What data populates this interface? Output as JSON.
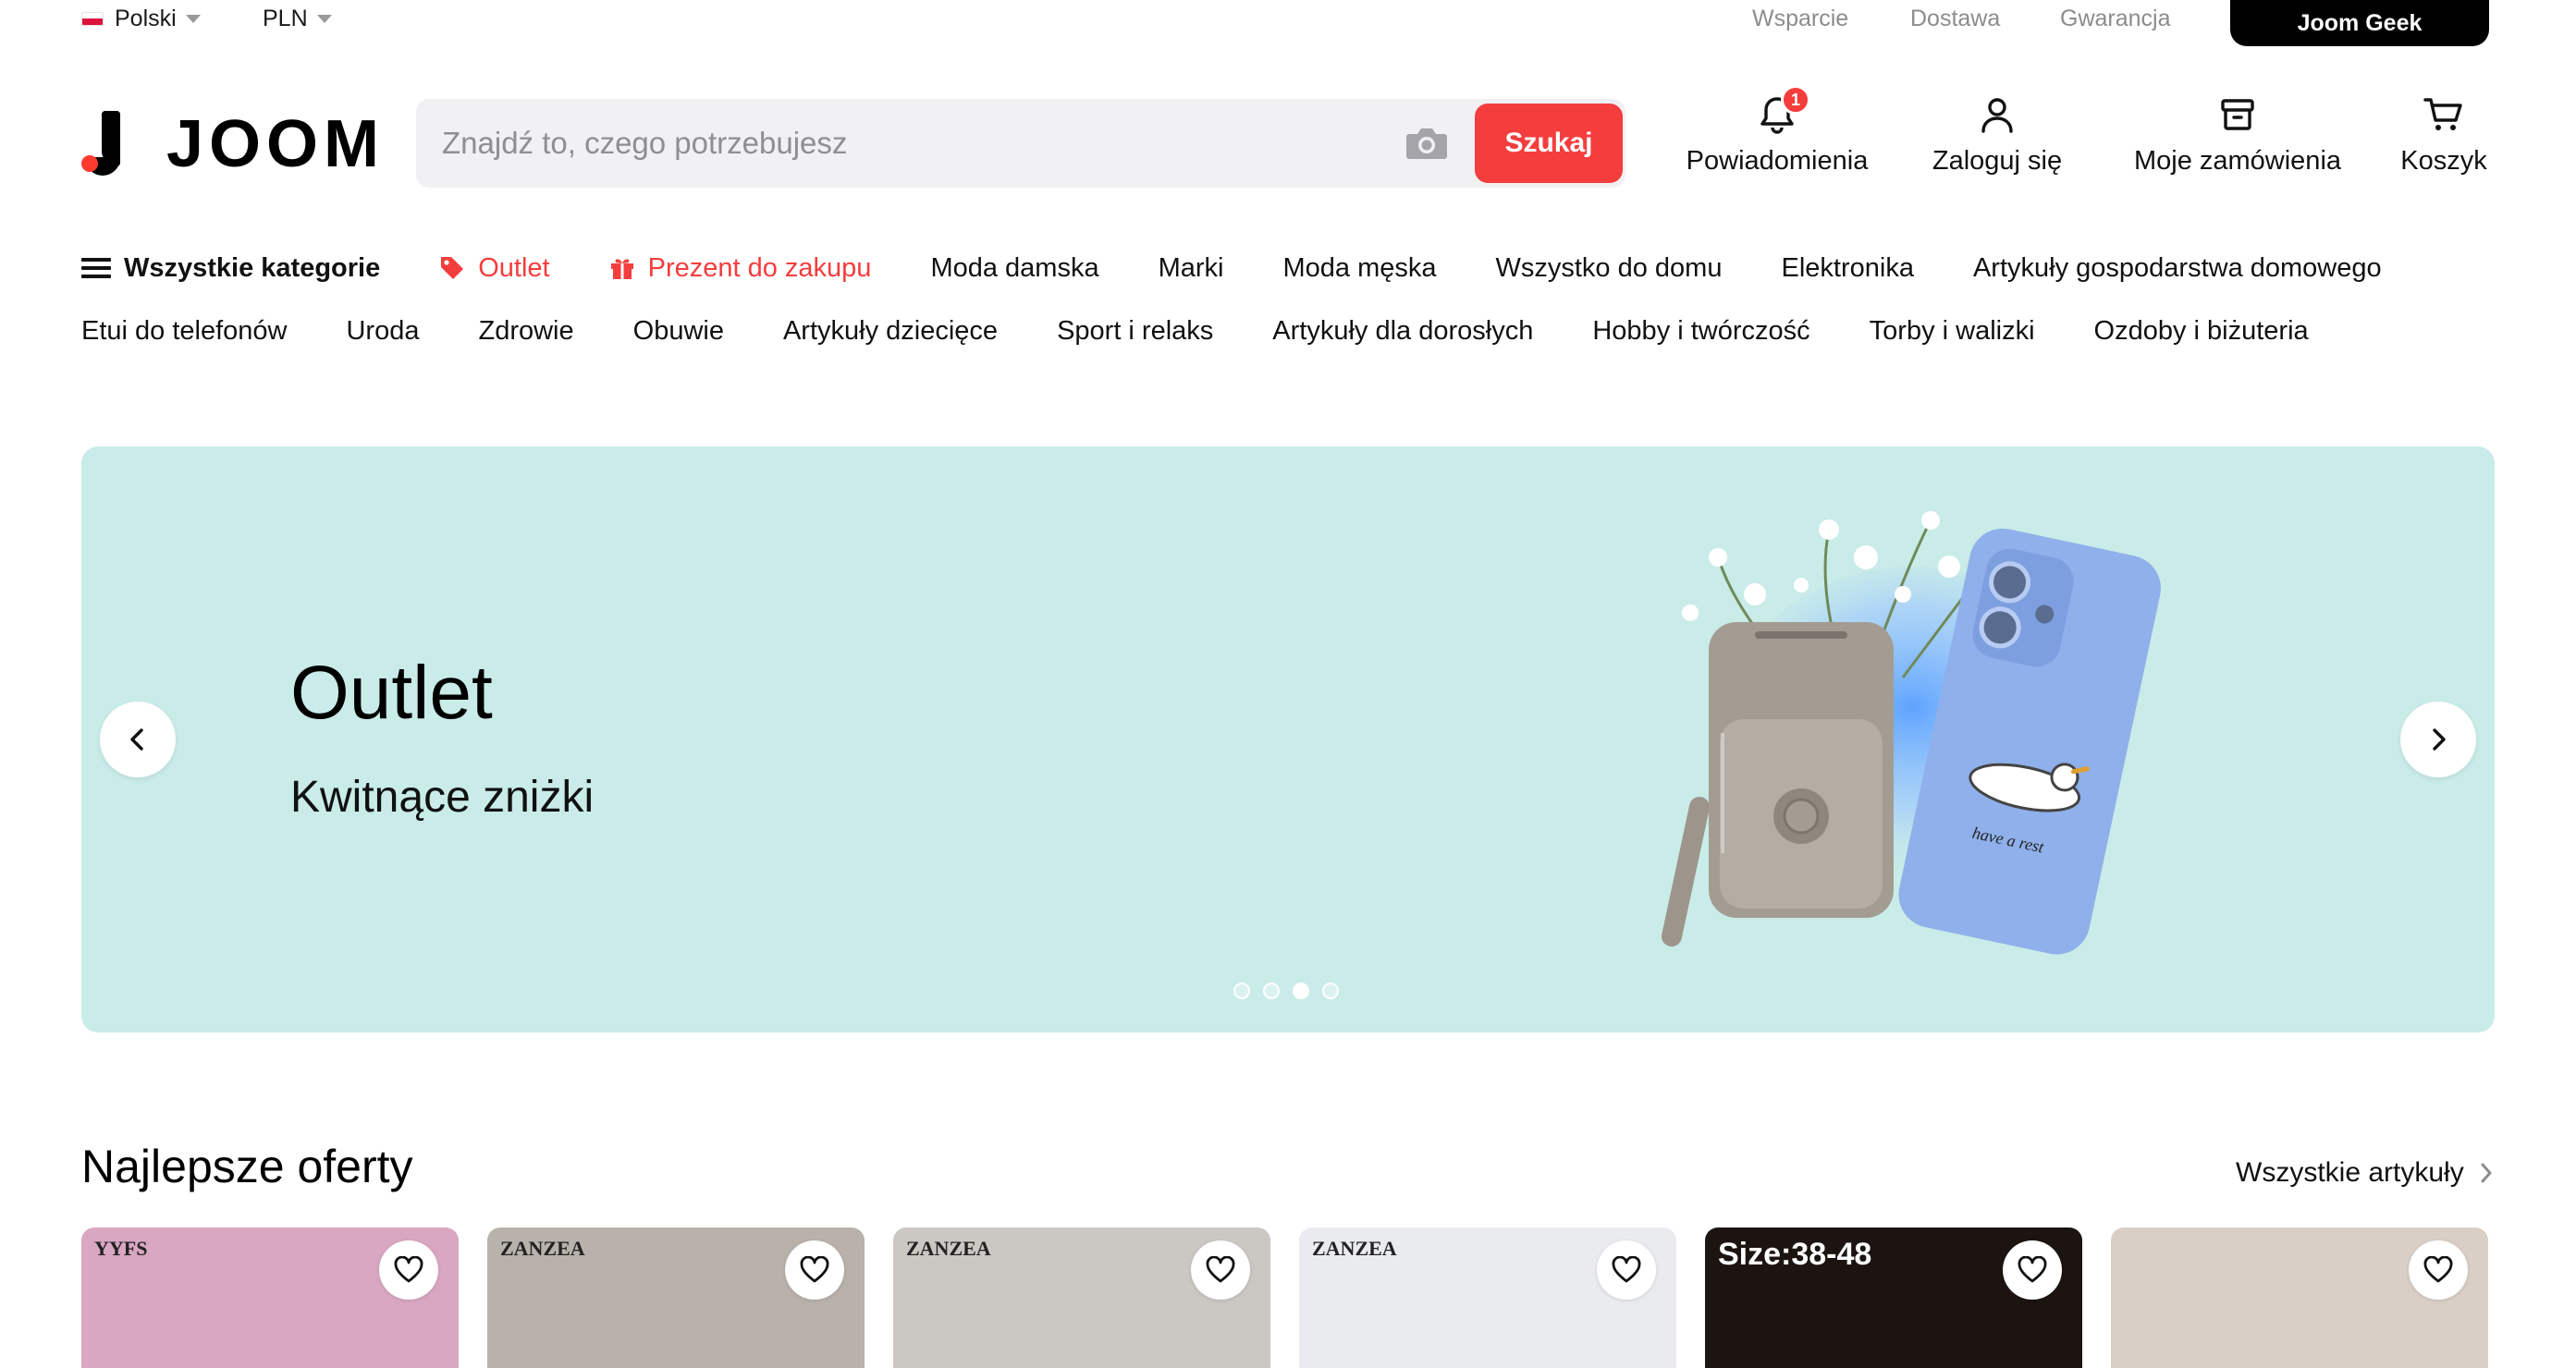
{
  "topbar": {
    "language": "Polski",
    "currency": "PLN",
    "links": [
      "Wsparcie",
      "Dostawa",
      "Gwarancja"
    ],
    "geek_button": "Joom Geek"
  },
  "header": {
    "logo_text": "JOOM",
    "search_placeholder": "Znajdź to, czego potrzebujesz",
    "search_button": "Szukaj",
    "actions": {
      "notifications": {
        "label": "Powiadomienia",
        "badge": "1"
      },
      "login": {
        "label": "Zaloguj się"
      },
      "orders": {
        "label": "Moje zamówienia"
      },
      "cart": {
        "label": "Koszyk"
      }
    }
  },
  "categories": {
    "row1": [
      "Wszystkie kategorie",
      "Outlet",
      "Prezent do zakupu",
      "Moda damska",
      "Marki",
      "Moda męska",
      "Wszystko do domu",
      "Elektronika",
      "Artykuły gospodarstwa domowego"
    ],
    "row2": [
      "Etui do telefonów",
      "Uroda",
      "Zdrowie",
      "Obuwie",
      "Artykuły dziecięce",
      "Sport i relaks",
      "Artykuły dla dorosłych",
      "Hobby i twórczość",
      "Torby i walizki",
      "Ozdoby i biżuteria"
    ]
  },
  "banner": {
    "title": "Outlet",
    "subtitle": "Kwitnące zniżki",
    "background": "#c9ece8",
    "phone_text": "have a rest",
    "slide_count": 4,
    "active_slide": 3
  },
  "deals": {
    "title": "Najlepsze oferty",
    "see_all": "Wszystkie artykuły",
    "products": [
      {
        "brand": "YYFS",
        "bg": "#d9a7c2"
      },
      {
        "brand": "ZANZEA",
        "bg": "#b8b2aa"
      },
      {
        "brand": "ZANZEA",
        "bg": "#cbc7c3"
      },
      {
        "brand": "ZANZEA",
        "bg": "#e9ebee"
      },
      {
        "brand": "Size:38-48",
        "bg": "#1b1410"
      },
      {
        "brand": "",
        "bg": "#d9cfc6"
      }
    ]
  },
  "colors": {
    "accent": "#f43d3d",
    "text": "#111111",
    "muted": "#8c8c8c"
  }
}
